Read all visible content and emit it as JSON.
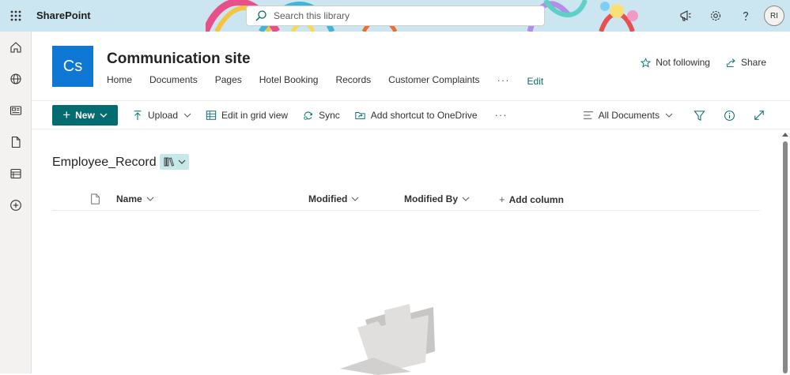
{
  "suitebar": {
    "app_name": "SharePoint",
    "search_placeholder": "Search this library",
    "avatar_initials": "RI"
  },
  "site": {
    "logo_text": "Cs",
    "title": "Communication site",
    "nav": [
      "Home",
      "Documents",
      "Pages",
      "Hotel Booking",
      "Records",
      "Customer Complaints"
    ],
    "nav_more": "···",
    "edit_label": "Edit",
    "not_following_label": "Not following",
    "share_label": "Share"
  },
  "commandbar": {
    "new_label": "New",
    "upload_label": "Upload",
    "grid_label": "Edit in grid view",
    "sync_label": "Sync",
    "shortcut_label": "Add shortcut to OneDrive",
    "more": "···",
    "view_label": "All Documents"
  },
  "library": {
    "title": "Employee_Record",
    "columns": {
      "name": "Name",
      "modified": "Modified",
      "modified_by": "Modified By",
      "add_column": "Add column"
    }
  },
  "colors": {
    "accent": "#036c70",
    "logo": "#0f78d4",
    "suitebar": "#cbe6f0"
  }
}
